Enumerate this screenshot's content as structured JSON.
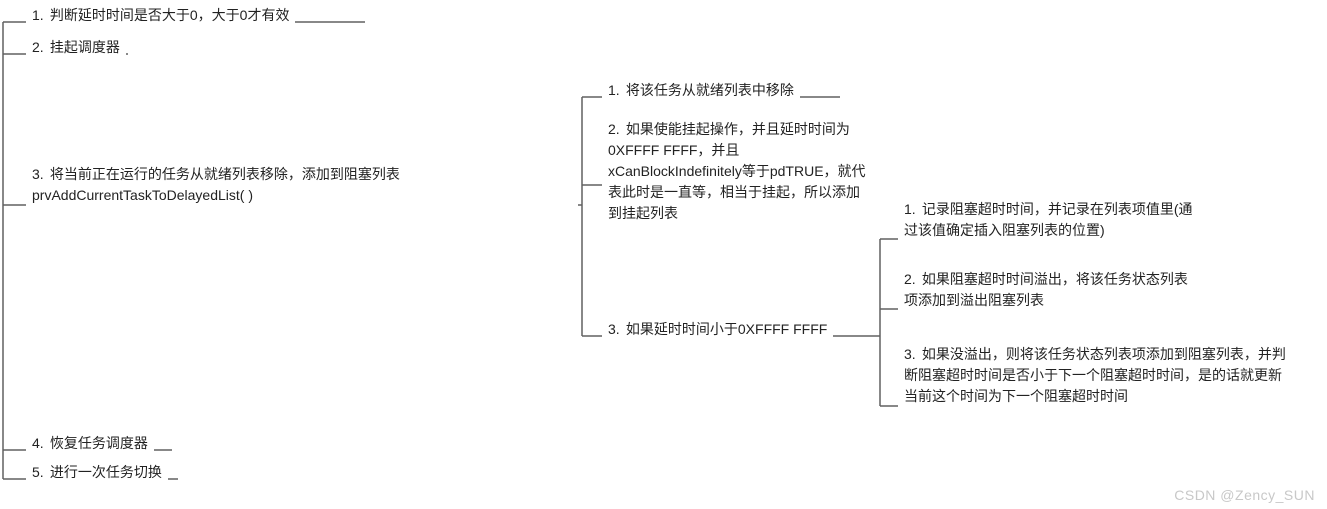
{
  "level1": {
    "n1": {
      "num": "1.",
      "text": "判断延时时间是否大于0，大于0才有效"
    },
    "n2": {
      "num": "2.",
      "text": "挂起调度器"
    },
    "n3": {
      "num": "3.",
      "text": "将当前正在运行的任务从就绪列表移除，添加到阻塞列表prvAddCurrentTaskToDelayedList( )"
    },
    "n4": {
      "num": "4.",
      "text": "恢复任务调度器"
    },
    "n5": {
      "num": "5.",
      "text": "进行一次任务切换"
    }
  },
  "level2": {
    "n1": {
      "num": "1.",
      "text": "将该任务从就绪列表中移除"
    },
    "n2": {
      "num": "2.",
      "text": "如果使能挂起操作，并且延时时间为0XFFFF FFFF，并且xCanBlockIndefinitely等于pdTRUE，就代表此时是一直等，相当于挂起，所以添加到挂起列表"
    },
    "n3": {
      "num": "3.",
      "text": "如果延时时间小于0XFFFF FFFF"
    }
  },
  "level3": {
    "n1": {
      "num": "1.",
      "text": "记录阻塞超时时间，并记录在列表项值里(通过该值确定插入阻塞列表的位置)"
    },
    "n2": {
      "num": "2.",
      "text": "如果阻塞超时时间溢出，将该任务状态列表项添加到溢出阻塞列表"
    },
    "n3": {
      "num": "3.",
      "text": "如果没溢出，则将该任务状态列表项添加到阻塞列表，并判断阻塞超时时间是否小于下一个阻塞超时时间，是的话就更新当前这个时间为下一个阻塞超时时间"
    }
  },
  "watermark": "CSDN @Zency_SUN"
}
